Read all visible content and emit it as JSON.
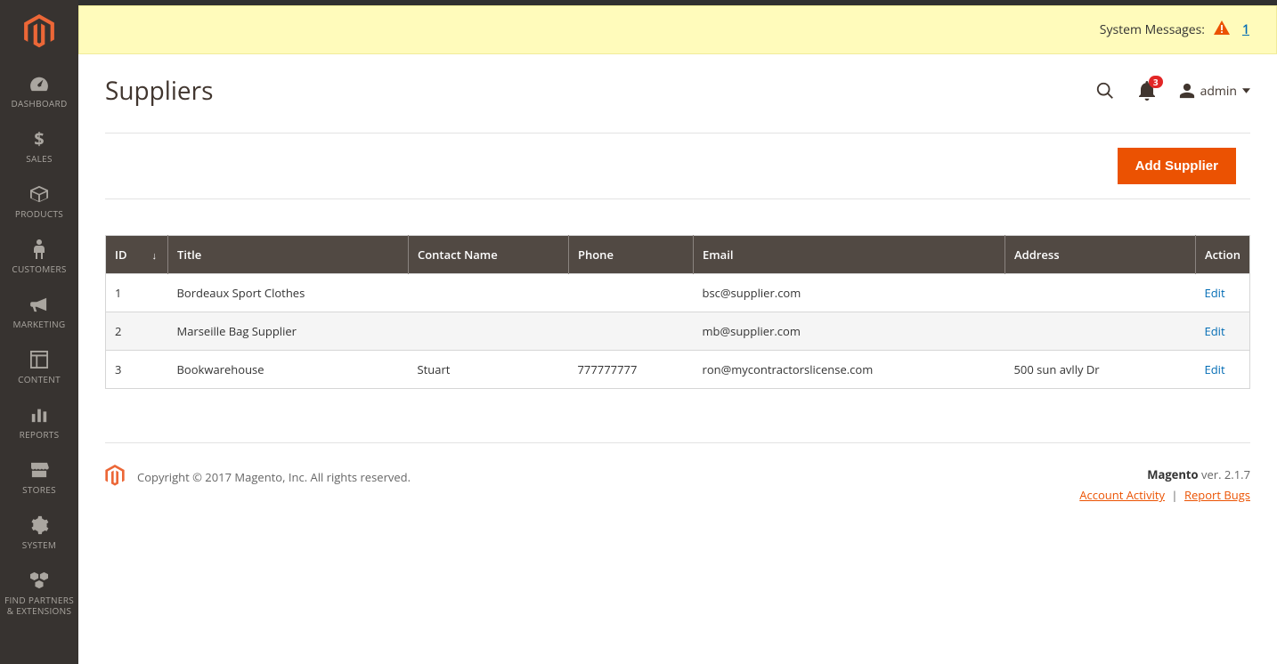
{
  "sidebar": {
    "items": [
      {
        "label": "DASHBOARD",
        "icon": "dashboard-icon"
      },
      {
        "label": "SALES",
        "icon": "dollar-icon"
      },
      {
        "label": "PRODUCTS",
        "icon": "box-icon"
      },
      {
        "label": "CUSTOMERS",
        "icon": "person-icon"
      },
      {
        "label": "MARKETING",
        "icon": "megaphone-icon"
      },
      {
        "label": "CONTENT",
        "icon": "layout-icon"
      },
      {
        "label": "REPORTS",
        "icon": "bar-chart-icon"
      },
      {
        "label": "STORES",
        "icon": "storefront-icon"
      },
      {
        "label": "SYSTEM",
        "icon": "gear-icon"
      },
      {
        "label": "FIND PARTNERS\n& EXTENSIONS",
        "icon": "blocks-icon"
      }
    ]
  },
  "system_messages": {
    "label": "System Messages:",
    "count": "1"
  },
  "page": {
    "title": "Suppliers"
  },
  "header": {
    "notification_count": "3",
    "user_name": "admin"
  },
  "actions": {
    "add_supplier": "Add Supplier"
  },
  "table": {
    "columns": {
      "id": "ID",
      "title": "Title",
      "contact": "Contact Name",
      "phone": "Phone",
      "email": "Email",
      "address": "Address",
      "action": "Action"
    },
    "edit_label": "Edit",
    "rows": [
      {
        "id": "1",
        "title": "Bordeaux Sport Clothes",
        "contact": "",
        "phone": "",
        "email": "bsc@supplier.com",
        "address": ""
      },
      {
        "id": "2",
        "title": "Marseille Bag Supplier",
        "contact": "",
        "phone": "",
        "email": "mb@supplier.com",
        "address": ""
      },
      {
        "id": "3",
        "title": "Bookwarehouse",
        "contact": "Stuart",
        "phone": "777777777",
        "email": "ron@mycontractorslicense.com",
        "address": "500 sun avlly Dr"
      }
    ]
  },
  "footer": {
    "copyright": "Copyright © 2017 Magento, Inc. All rights reserved.",
    "version_prefix": "Magento",
    "version_suffix": " ver. 2.1.7",
    "account_activity": "Account Activity",
    "report_bugs": "Report Bugs"
  }
}
